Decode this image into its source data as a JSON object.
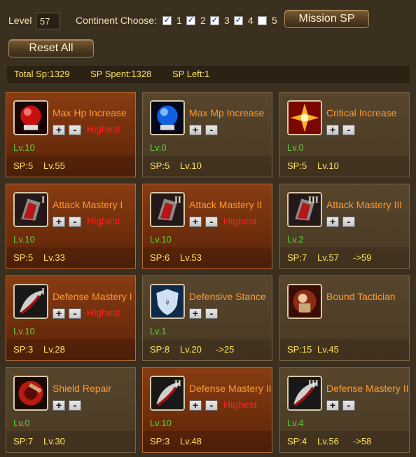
{
  "header": {
    "level_label": "Level",
    "level_value": "57",
    "continent_label": "Continent Choose:",
    "continents": [
      {
        "num": "1",
        "checked": true
      },
      {
        "num": "2",
        "checked": true
      },
      {
        "num": "3",
        "checked": true
      },
      {
        "num": "4",
        "checked": true
      },
      {
        "num": "5",
        "checked": false
      }
    ],
    "mission_button": "Mission SP",
    "reset_button": "Reset All"
  },
  "stats": {
    "total_sp": "Total Sp:1329",
    "sp_spent": "SP Spent:1328",
    "sp_left": "SP Left:1"
  },
  "colors": {
    "name": "#ff9a2a",
    "highest": "#ff2020",
    "level": "#5fcf3a",
    "sp": "#ffe35c"
  },
  "skills": [
    {
      "name": "Max Hp Increase",
      "icon": "hp-orb-icon",
      "active": true,
      "highest": "Highest",
      "level": "Lv.10",
      "sp": "SP:5",
      "req": "Lv.55",
      "next": ""
    },
    {
      "name": "Max Mp Increase",
      "icon": "mp-orb-icon",
      "active": false,
      "highest": "",
      "level": "Lv.0",
      "sp": "SP:5",
      "req": "Lv.10",
      "next": ""
    },
    {
      "name": "Critical Increase",
      "icon": "critical-burst-icon",
      "active": false,
      "highest": "",
      "level": "Lv.0",
      "sp": "SP:5",
      "req": "Lv.10",
      "next": ""
    },
    {
      "name": "Attack Mastery I",
      "icon": "attack-mastery-icon",
      "active": true,
      "highest": "Highest",
      "level": "Lv.10",
      "sp": "SP:5",
      "req": "Lv.33",
      "next": "",
      "roman": "I"
    },
    {
      "name": "Attack Mastery II",
      "icon": "attack-mastery-icon",
      "active": true,
      "highest": "Highest",
      "level": "Lv.10",
      "sp": "SP:6",
      "req": "Lv.53",
      "next": "",
      "roman": "II"
    },
    {
      "name": "Attack Mastery III",
      "icon": "attack-mastery-icon",
      "active": false,
      "highest": "",
      "level": "Lv.2",
      "sp": "SP:7",
      "req": "Lv.57",
      "next": "->59",
      "roman": "III"
    },
    {
      "name": "Defense Mastery I",
      "icon": "defense-mastery-icon",
      "active": true,
      "highest": "Highest",
      "level": "Lv.10",
      "sp": "SP:3",
      "req": "Lv.28",
      "next": "",
      "roman": "I"
    },
    {
      "name": "Defensive Stance",
      "icon": "defensive-stance-icon",
      "active": false,
      "highest": "",
      "level": "Lv.1",
      "sp": "SP:8",
      "req": "Lv.20",
      "next": "->25"
    },
    {
      "name": "Bound Tactician",
      "icon": "bound-tactician-icon",
      "active": false,
      "highest": "",
      "level": "",
      "sp": "SP:15",
      "req": "Lv.45",
      "next": "",
      "hide_pm": true
    },
    {
      "name": "Shield Repair",
      "icon": "shield-repair-icon",
      "active": false,
      "highest": "",
      "level": "Lv.0",
      "sp": "SP:7",
      "req": "Lv.30",
      "next": ""
    },
    {
      "name": "Defense Mastery II",
      "icon": "defense-mastery-icon",
      "active": true,
      "highest": "Highest",
      "level": "Lv.10",
      "sp": "SP:3",
      "req": "Lv.48",
      "next": "",
      "roman": "II"
    },
    {
      "name": "Defense Mastery III",
      "icon": "defense-mastery-icon",
      "active": false,
      "highest": "",
      "level": "Lv.4",
      "sp": "SP:4",
      "req": "Lv.56",
      "next": "->58",
      "roman": "III"
    }
  ]
}
